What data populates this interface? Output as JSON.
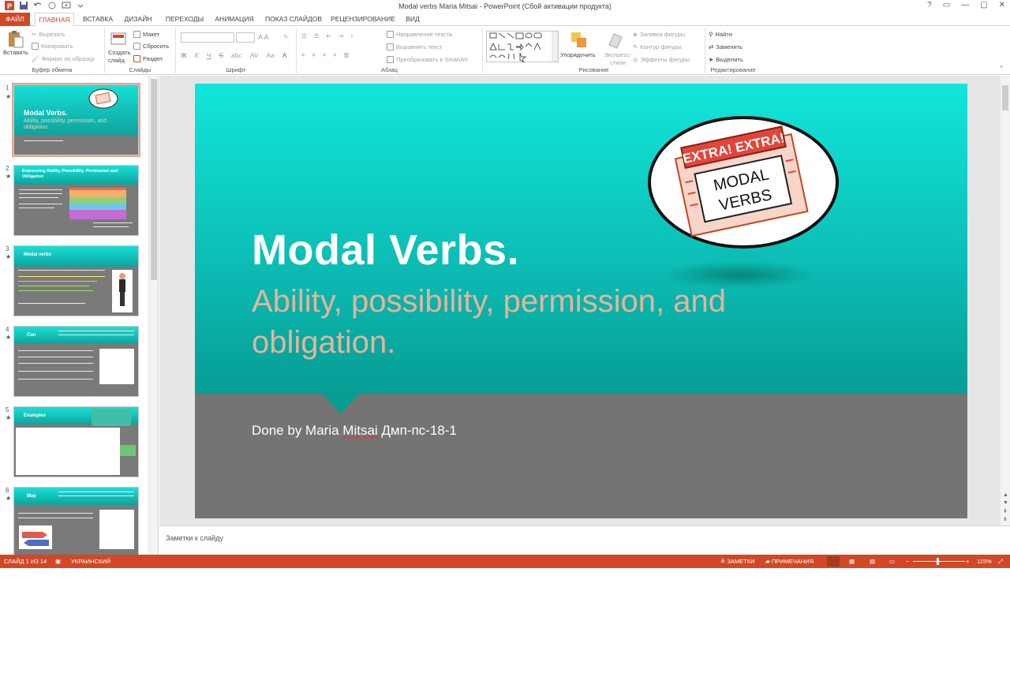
{
  "window": {
    "title": "Modal verbs Maria Mitsai - PowerPoint (Сбой активации продукта)",
    "controls": [
      "?",
      "▭",
      "—",
      "▢",
      "✕"
    ]
  },
  "tabs": [
    {
      "label": "ФАЙЛ"
    },
    {
      "label": "ГЛАВНАЯ"
    },
    {
      "label": "ВСТАВКА"
    },
    {
      "label": "ДИЗАЙН"
    },
    {
      "label": "ПЕРЕХОДЫ"
    },
    {
      "label": "АНИМАЦИЯ"
    },
    {
      "label": "ПОКАЗ СЛАЙДОВ"
    },
    {
      "label": "РЕЦЕНЗИРОВАНИЕ"
    },
    {
      "label": "ВИД"
    }
  ],
  "ribbon": {
    "clipboard": {
      "group_label": "Буфер обмена",
      "paste": "Вставить",
      "cut": "Вырезать",
      "copy": "Копировать",
      "format_painter": "Формат по образцу"
    },
    "slides": {
      "group_label": "Слайды",
      "new_slide": "Создать слайд",
      "layout": "Макет",
      "reset": "Сбросить",
      "section": "Раздел"
    },
    "font": {
      "group_label": "Шрифт",
      "bold": "Ж",
      "italic": "К",
      "underline": "Ч",
      "strike": "S",
      "abc": "abc",
      "spacing": "AV",
      "case": "Aa"
    },
    "paragraph": {
      "group_label": "Абзац",
      "text_direction": "Направление текста",
      "align_text": "Выровнять текст",
      "smartart": "Преобразовать в SmartArt"
    },
    "drawing": {
      "group_label": "Рисование",
      "arrange": "Упорядочить",
      "quick_styles": "Экспресс-стили",
      "shape_fill": "Заливка фигуры",
      "shape_outline": "Контур фигуры",
      "shape_effects": "Эффекты фигуры"
    },
    "editing": {
      "group_label": "Редактирование",
      "find": "Найти",
      "replace": "Заменить",
      "select": "Выделить"
    }
  },
  "thumbnails": [
    {
      "num": "1",
      "title": "Modal Verbs.",
      "sub": "Ability, possibility, permission, and obligation."
    },
    {
      "num": "2",
      "title": "Expressing Ability, Possibility, Permission and Obligation"
    },
    {
      "num": "3",
      "title": "Modal verbs"
    },
    {
      "num": "4",
      "title": "Can"
    },
    {
      "num": "5",
      "title": "Examples"
    },
    {
      "num": "6",
      "title": "May"
    }
  ],
  "slide": {
    "title": "Modal Verbs.",
    "subtitle": "Ability, possibility, permission, and obligation.",
    "author_prefix": "Done by Maria ",
    "author_name": "Mitsai",
    "author_suffix": " Дмп-пс-18-1",
    "badge_line1": "EXTRA! EXTRA!",
    "badge_line2": "MODAL",
    "badge_line3": "VERBS"
  },
  "notes": {
    "placeholder": "Заметки к слайду"
  },
  "status": {
    "slide_counter": "СЛАЙД 1 ИЗ 14",
    "language": "УКРАИНСКИЙ",
    "notes_btn": "ЗАМЕТКИ",
    "comments_btn": "ПРИМЕЧАНИЯ",
    "zoom": "115%"
  },
  "colors": {
    "accent": "#d24726",
    "teal_top": "#12e6db",
    "teal_bottom": "#079d95",
    "slide_gray": "#747474",
    "subtitle": "#e4b49b"
  }
}
